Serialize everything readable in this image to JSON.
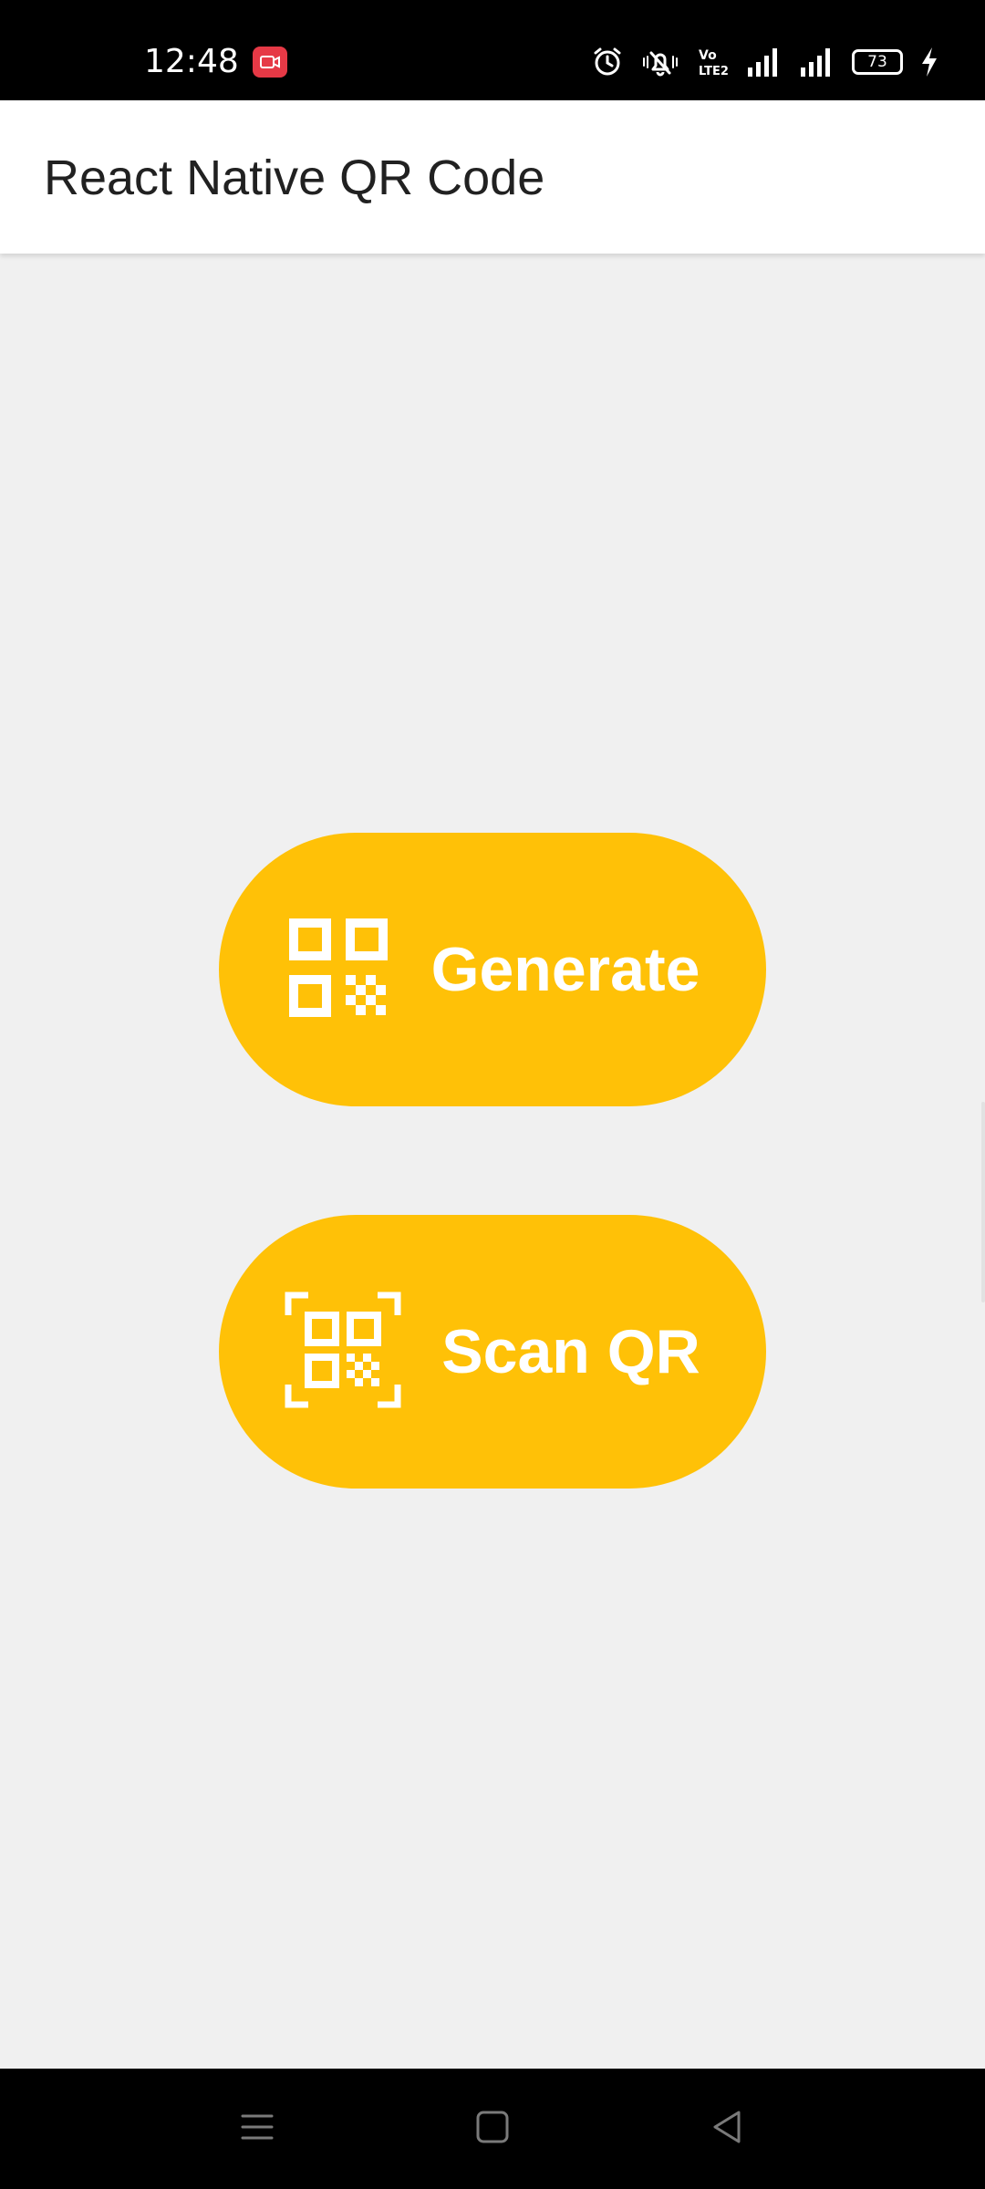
{
  "status_bar": {
    "time": "12:48",
    "battery_level": "73",
    "icons": [
      "screen-recorder-icon",
      "alarm-icon",
      "notifications-muted-icon",
      "volte-icon",
      "signal-icon",
      "signal-icon",
      "battery-icon",
      "charging-icon"
    ]
  },
  "app_bar": {
    "title": "React Native QR Code"
  },
  "main": {
    "generate_button": {
      "label": "Generate",
      "icon": "qr-code-icon"
    },
    "scan_button": {
      "label": "Scan QR",
      "icon": "qr-scan-icon"
    }
  },
  "nav_bar": {
    "buttons": [
      "menu-icon",
      "home-icon",
      "back-icon"
    ]
  },
  "colors": {
    "accent": "#ffc107",
    "background": "#f0f0f0",
    "app_bar": "#ffffff",
    "system_bars": "#000000"
  }
}
